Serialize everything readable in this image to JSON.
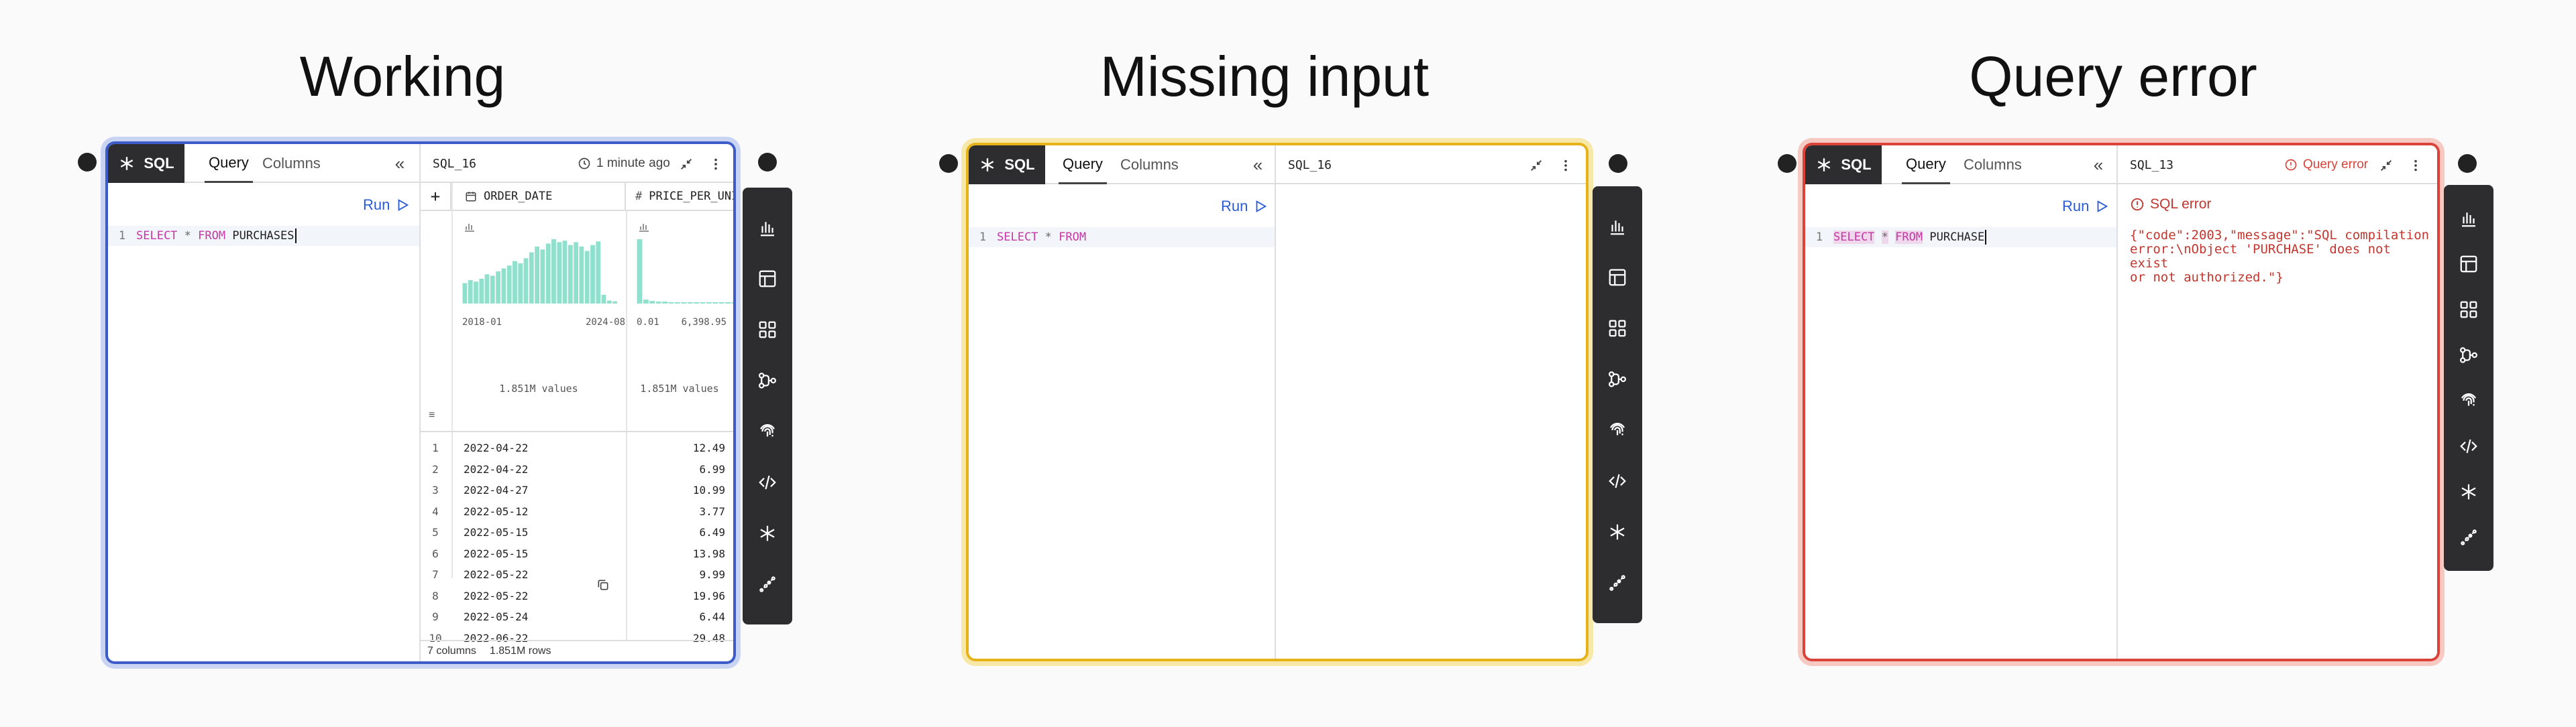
{
  "titles": {
    "working": "Working",
    "missing": "Missing input",
    "error": "Query error"
  },
  "colors": {
    "working_ring": "#3d5cc9",
    "missing_ring": "#e6b21a",
    "error_ring": "#d9433a",
    "keyword": "#c637a5",
    "run": "#2a5bd7",
    "hist": "#8fe0cc"
  },
  "common": {
    "badge": "SQL",
    "tab_query": "Query",
    "tab_columns": "Columns",
    "run": "Run",
    "line_no": "1",
    "kw_select": "SELECT",
    "kw_star": "*",
    "kw_from": "FROM"
  },
  "working": {
    "cell_name": "SQL_16",
    "status": "1 minute ago",
    "table_name": "PURCHASES",
    "columns": [
      {
        "name": "ORDER_DATE",
        "type_icon": "calendar-icon",
        "min": "2018-01",
        "max": "2024-08",
        "count": "1.851M values"
      },
      {
        "name": "PRICE_PER_UNIT",
        "type_icon": "hash-icon",
        "min": "0.01",
        "max": "6,398.95",
        "count": "1.851M values"
      }
    ],
    "hist_order_date": [
      28,
      32,
      30,
      34,
      40,
      38,
      44,
      48,
      52,
      58,
      55,
      62,
      70,
      78,
      74,
      82,
      88,
      84,
      86,
      80,
      84,
      78,
      72,
      80,
      85,
      12,
      4,
      3
    ],
    "hist_price": [
      98,
      6,
      4,
      3,
      3,
      2,
      2,
      2,
      2,
      2,
      2,
      2,
      2,
      2,
      2,
      2,
      2,
      2,
      2,
      2
    ],
    "rows": [
      {
        "n": "1",
        "date": "2022-04-22",
        "price": "12.49"
      },
      {
        "n": "2",
        "date": "2022-04-22",
        "price": "6.99"
      },
      {
        "n": "3",
        "date": "2022-04-27",
        "price": "10.99"
      },
      {
        "n": "4",
        "date": "2022-05-12",
        "price": "3.77"
      },
      {
        "n": "5",
        "date": "2022-05-15",
        "price": "6.49"
      },
      {
        "n": "6",
        "date": "2022-05-15",
        "price": "13.98"
      },
      {
        "n": "7",
        "date": "2022-05-22",
        "price": "9.99"
      },
      {
        "n": "8",
        "date": "2022-05-22",
        "price": "19.96"
      },
      {
        "n": "9",
        "date": "2022-05-24",
        "price": "6.44"
      },
      {
        "n": "10",
        "date": "2022-06-22",
        "price": "29.48"
      }
    ],
    "footer_cols": "7 columns",
    "footer_rows": "1.851M rows"
  },
  "missing": {
    "cell_name": "SQL_16"
  },
  "error": {
    "cell_name": "SQL_13",
    "status": "Query error",
    "table_name": "PURCHASE",
    "error_title": "SQL error",
    "error_message": "{\"code\":2003,\"message\":\"SQL compilation\nerror:\\nObject 'PURCHASE' does not exist\nor not authorized.\"}"
  },
  "toolbar_icons": [
    "bar-chart-icon",
    "table-icon",
    "grid-icon",
    "flow-icon",
    "fingerprint-icon",
    "code-icon",
    "asterisk-icon",
    "scatter-line-icon"
  ]
}
